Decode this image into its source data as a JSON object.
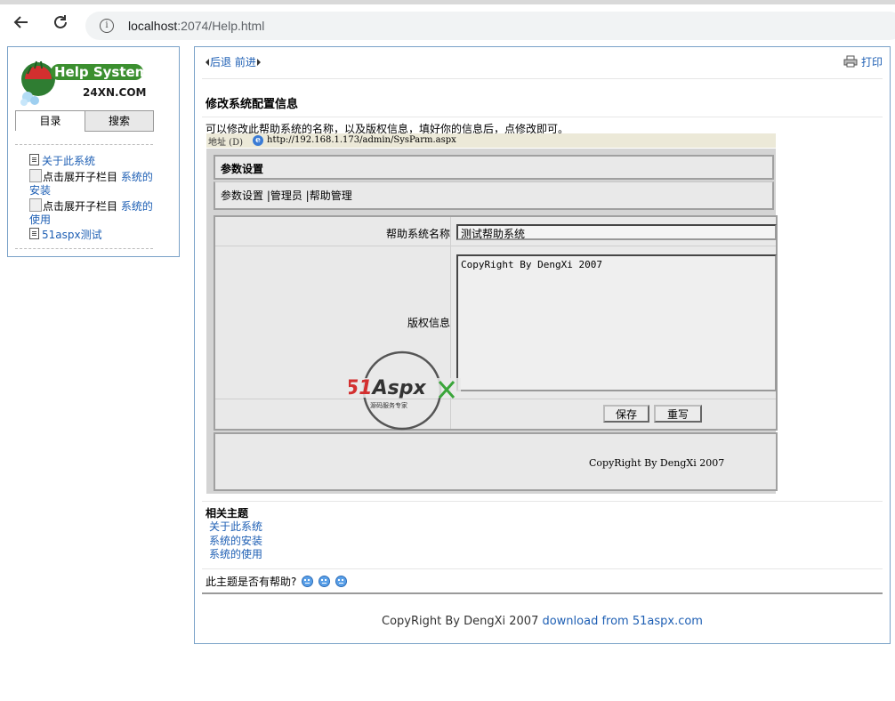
{
  "browser": {
    "url_host": "localhost",
    "url_rest": ":2074/Help.html",
    "back_icon": "back-arrow-icon",
    "reload_icon": "reload-icon"
  },
  "sidebar": {
    "logo_title": "Help System",
    "logo_sub": "24XN.COM",
    "tabs": [
      {
        "label": "目录"
      },
      {
        "label": "搜索"
      }
    ],
    "tree": [
      {
        "label": "关于此系统",
        "type": "doc"
      },
      {
        "alt": "点击展开子栏目",
        "label_a": "系统的",
        "label_b": "安装",
        "type": "folder"
      },
      {
        "alt": "点击展开子栏目",
        "label_a": "系统的",
        "label_b": "使用",
        "type": "folder"
      },
      {
        "label": "51aspx测试",
        "type": "doc"
      }
    ]
  },
  "main": {
    "back_label": "后退",
    "forward_label": "前进",
    "print_label": "打印",
    "title": "修改系统配置信息",
    "intro": "可以修改此帮助系统的名称，以及版权信息，填好你的信息后，点修改即可。",
    "screenshot": {
      "address_label": "地址 (D)",
      "address_url": "http://192.168.1.173/admin/SysParm.aspx",
      "panel_title": "参数设置",
      "links": "参数设置 |管理员 |帮助管理",
      "field1_label": "帮助系统名称",
      "field1_value": "测试帮助系统",
      "field2_label": "版权信息",
      "field2_value": "CopyRight By DengXi 2007",
      "save_label": "保存",
      "reset_label": "重写",
      "footer_text": "CopyRight By DengXi 2007",
      "watermark_brand": "51Aspx",
      "watermark_tagline": "源码服务专家"
    },
    "related_heading": "相关主题",
    "related": [
      "关于此系统",
      "系统的安装",
      "系统的使用"
    ],
    "helpful_label": "此主题是否有帮助?",
    "footer_text": "CopyRight By DengXi 2007 ",
    "footer_link": "download from 51aspx.com"
  }
}
